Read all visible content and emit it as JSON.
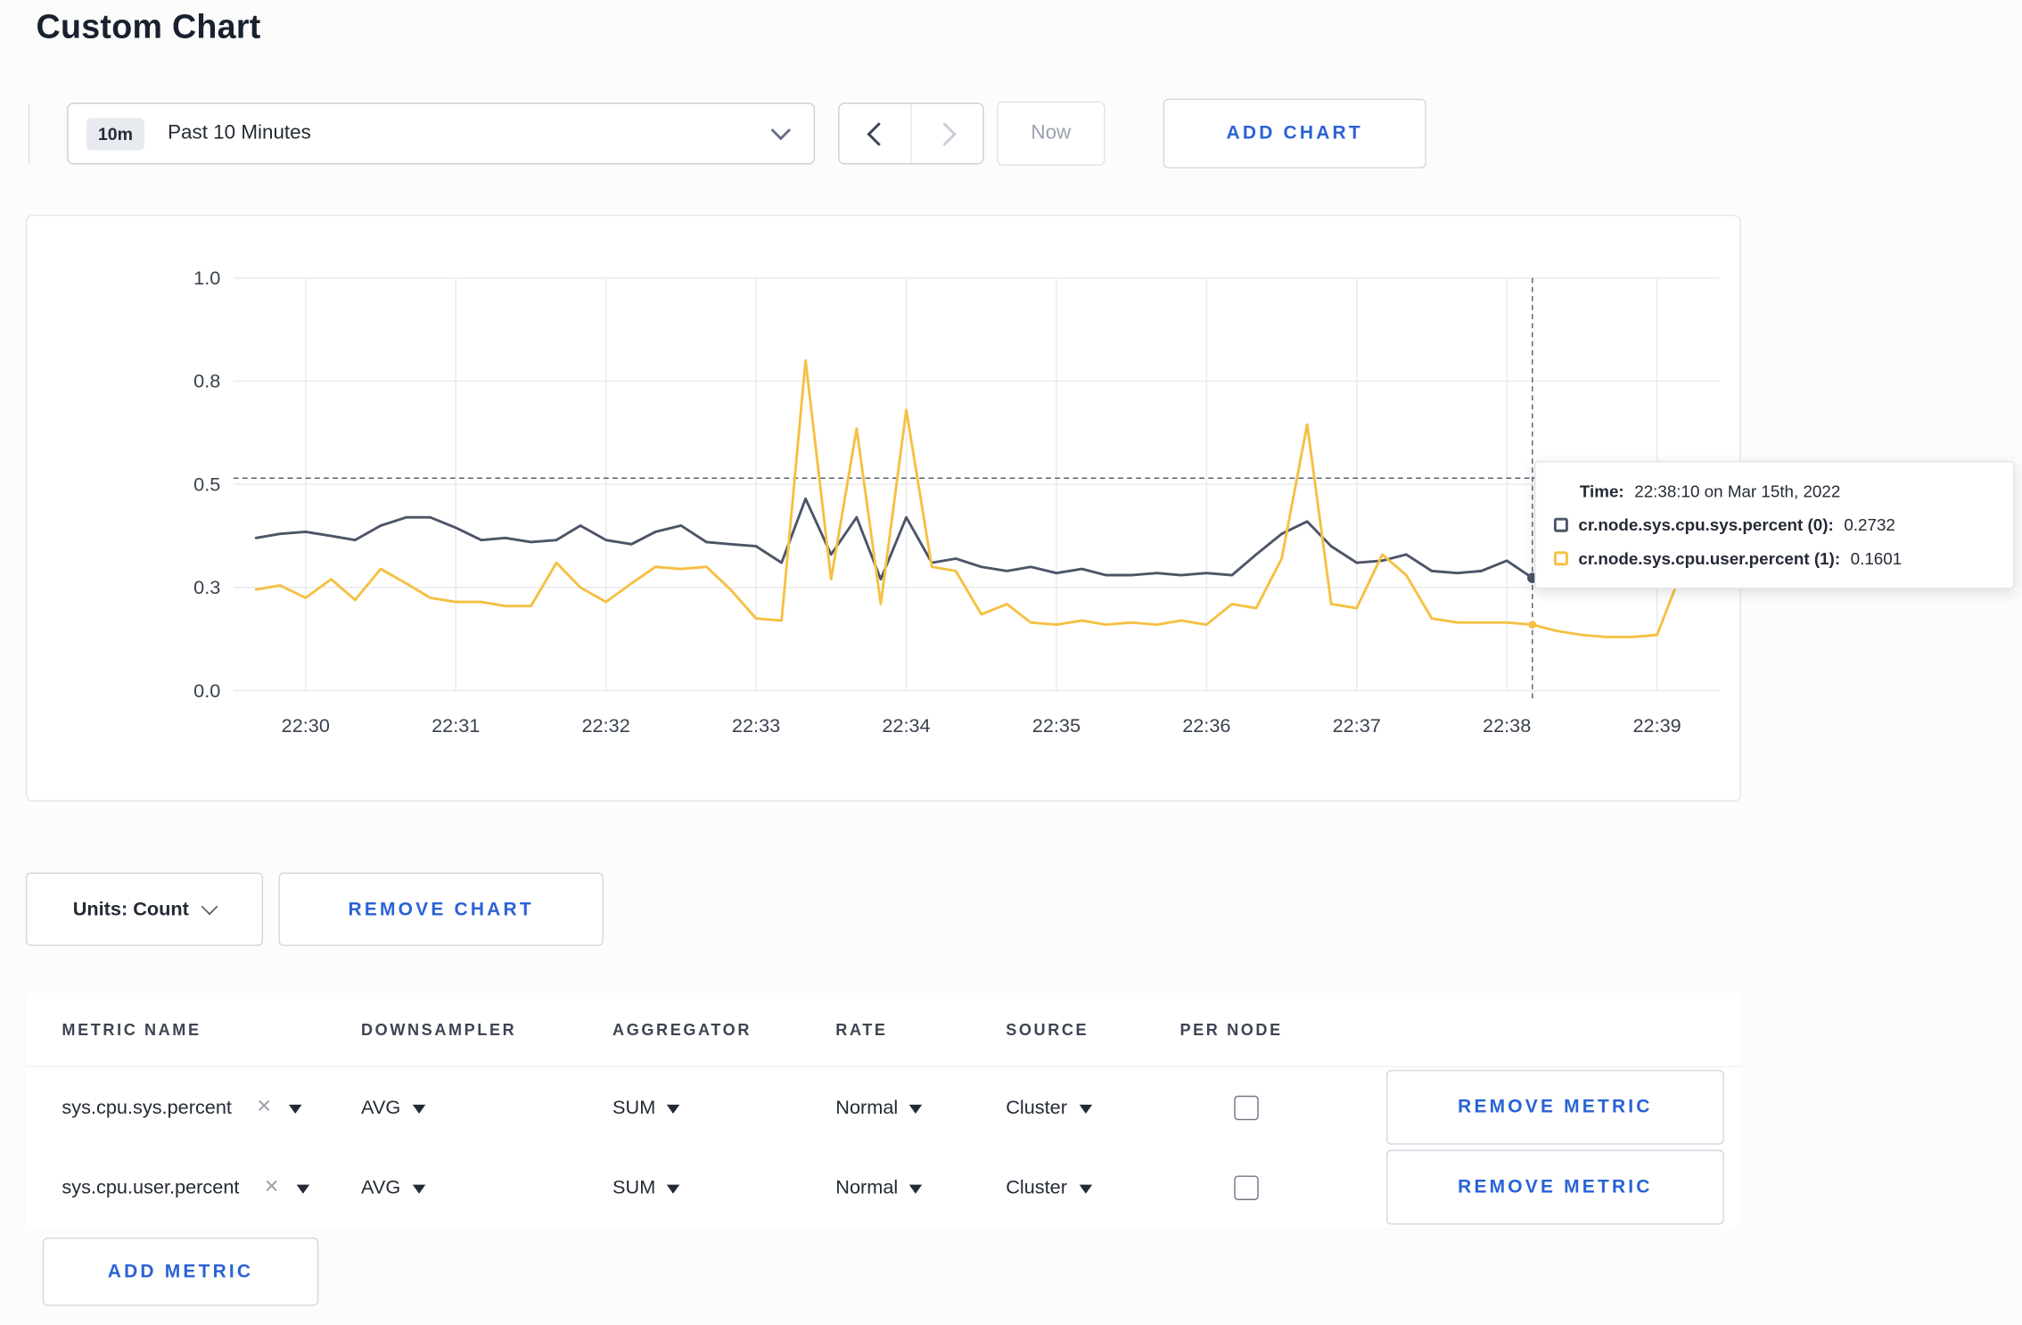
{
  "page": {
    "title": "Custom Chart",
    "accent_blue": "#2a62d6",
    "background": "#fcfcfd"
  },
  "toolbar": {
    "range_badge": "10m",
    "range_label": "Past 10 Minutes",
    "now_label": "Now",
    "add_chart_label": "ADD CHART"
  },
  "tooltip": {
    "time_label": "Time:",
    "time_value": "22:38:10 on Mar 15th, 2022",
    "rows": [
      {
        "label": "cr.node.sys.cpu.sys.percent (0):",
        "value": "0.2732",
        "color": "#4c5567"
      },
      {
        "label": "cr.node.sys.cpu.user.percent (1):",
        "value": "0.1601",
        "color": "#f5c043"
      }
    ]
  },
  "chart_footer": {
    "units_label": "Units: Count",
    "remove_chart_label": "REMOVE CHART"
  },
  "metrics_table": {
    "headers": [
      "METRIC NAME",
      "DOWNSAMPLER",
      "AGGREGATOR",
      "RATE",
      "SOURCE",
      "PER NODE"
    ],
    "rows": [
      {
        "metric": "sys.cpu.sys.percent",
        "downsampler": "AVG",
        "aggregator": "SUM",
        "rate": "Normal",
        "source": "Cluster",
        "per_node_checked": false,
        "remove_label": "REMOVE METRIC"
      },
      {
        "metric": "sys.cpu.user.percent",
        "downsampler": "AVG",
        "aggregator": "SUM",
        "rate": "Normal",
        "source": "Cluster",
        "per_node_checked": false,
        "remove_label": "REMOVE METRIC"
      }
    ],
    "add_metric_label": "ADD METRIC"
  },
  "chart_data": {
    "type": "line",
    "title": "",
    "grid": true,
    "y_domain": [
      0,
      1
    ],
    "y_ticks": [
      {
        "v": 0,
        "label": "0.0"
      },
      {
        "v": 0.25,
        "label": "0.3"
      },
      {
        "v": 0.5,
        "label": "0.5"
      },
      {
        "v": 0.75,
        "label": "0.8"
      },
      {
        "v": 1,
        "label": "1.0"
      }
    ],
    "x_ticks": [
      {
        "v": 30,
        "label": "22:30"
      },
      {
        "v": 31,
        "label": "22:31"
      },
      {
        "v": 32,
        "label": "22:32"
      },
      {
        "v": 33,
        "label": "22:33"
      },
      {
        "v": 34,
        "label": "22:34"
      },
      {
        "v": 35,
        "label": "22:35"
      },
      {
        "v": 36,
        "label": "22:36"
      },
      {
        "v": 37,
        "label": "22:37"
      },
      {
        "v": 38,
        "label": "22:38"
      },
      {
        "v": 39,
        "label": "22:39"
      }
    ],
    "crosshair": {
      "x": 38.17,
      "y": 0.515
    },
    "markers": [
      {
        "x": 38.17,
        "y": 0.2732,
        "color": "#4c5567",
        "r": 4
      },
      {
        "x": 38.17,
        "y": 0.1601,
        "color": "#f5c043",
        "r": 3
      }
    ],
    "series": [
      {
        "name": "cr.node.sys.cpu.sys.percent",
        "color": "#4c5567",
        "points": [
          [
            29.67,
            0.37
          ],
          [
            29.83,
            0.38
          ],
          [
            30,
            0.385
          ],
          [
            30.17,
            0.375
          ],
          [
            30.33,
            0.365
          ],
          [
            30.5,
            0.4
          ],
          [
            30.67,
            0.42
          ],
          [
            30.83,
            0.42
          ],
          [
            31,
            0.395
          ],
          [
            31.17,
            0.365
          ],
          [
            31.33,
            0.37
          ],
          [
            31.5,
            0.36
          ],
          [
            31.67,
            0.365
          ],
          [
            31.83,
            0.4
          ],
          [
            32,
            0.365
          ],
          [
            32.17,
            0.355
          ],
          [
            32.33,
            0.385
          ],
          [
            32.5,
            0.4
          ],
          [
            32.67,
            0.36
          ],
          [
            32.83,
            0.355
          ],
          [
            33,
            0.35
          ],
          [
            33.17,
            0.31
          ],
          [
            33.33,
            0.465
          ],
          [
            33.5,
            0.33
          ],
          [
            33.67,
            0.42
          ],
          [
            33.83,
            0.27
          ],
          [
            34,
            0.42
          ],
          [
            34.17,
            0.31
          ],
          [
            34.33,
            0.32
          ],
          [
            34.5,
            0.3
          ],
          [
            34.67,
            0.29
          ],
          [
            34.83,
            0.3
          ],
          [
            35,
            0.285
          ],
          [
            35.17,
            0.295
          ],
          [
            35.33,
            0.28
          ],
          [
            35.5,
            0.28
          ],
          [
            35.67,
            0.285
          ],
          [
            35.83,
            0.28
          ],
          [
            36,
            0.285
          ],
          [
            36.17,
            0.28
          ],
          [
            36.33,
            0.33
          ],
          [
            36.5,
            0.38
          ],
          [
            36.67,
            0.41
          ],
          [
            36.83,
            0.35
          ],
          [
            37,
            0.31
          ],
          [
            37.17,
            0.315
          ],
          [
            37.33,
            0.33
          ],
          [
            37.5,
            0.29
          ],
          [
            37.67,
            0.285
          ],
          [
            37.83,
            0.29
          ],
          [
            38,
            0.315
          ],
          [
            38.17,
            0.2732
          ]
        ]
      },
      {
        "name": "cr.node.sys.cpu.user.percent",
        "color": "#f5c043",
        "points": [
          [
            29.67,
            0.245
          ],
          [
            29.83,
            0.255
          ],
          [
            30,
            0.225
          ],
          [
            30.17,
            0.27
          ],
          [
            30.33,
            0.22
          ],
          [
            30.5,
            0.295
          ],
          [
            30.67,
            0.26
          ],
          [
            30.83,
            0.225
          ],
          [
            31,
            0.215
          ],
          [
            31.17,
            0.215
          ],
          [
            31.33,
            0.205
          ],
          [
            31.5,
            0.205
          ],
          [
            31.67,
            0.31
          ],
          [
            31.83,
            0.25
          ],
          [
            32,
            0.215
          ],
          [
            32.17,
            0.26
          ],
          [
            32.33,
            0.3
          ],
          [
            32.5,
            0.295
          ],
          [
            32.67,
            0.3
          ],
          [
            32.83,
            0.245
          ],
          [
            33,
            0.175
          ],
          [
            33.17,
            0.17
          ],
          [
            33.33,
            0.8
          ],
          [
            33.5,
            0.27
          ],
          [
            33.67,
            0.635
          ],
          [
            33.83,
            0.21
          ],
          [
            34,
            0.68
          ],
          [
            34.17,
            0.3
          ],
          [
            34.33,
            0.29
          ],
          [
            34.5,
            0.185
          ],
          [
            34.67,
            0.21
          ],
          [
            34.83,
            0.165
          ],
          [
            35,
            0.16
          ],
          [
            35.17,
            0.17
          ],
          [
            35.33,
            0.16
          ],
          [
            35.5,
            0.165
          ],
          [
            35.67,
            0.16
          ],
          [
            35.83,
            0.17
          ],
          [
            36,
            0.16
          ],
          [
            36.17,
            0.21
          ],
          [
            36.33,
            0.2
          ],
          [
            36.5,
            0.32
          ],
          [
            36.67,
            0.645
          ],
          [
            36.83,
            0.21
          ],
          [
            37,
            0.2
          ],
          [
            37.17,
            0.33
          ],
          [
            37.33,
            0.28
          ],
          [
            37.5,
            0.175
          ],
          [
            37.67,
            0.165
          ],
          [
            37.83,
            0.165
          ],
          [
            38,
            0.165
          ],
          [
            38.17,
            0.1601
          ],
          [
            38.33,
            0.145
          ],
          [
            38.5,
            0.135
          ],
          [
            38.67,
            0.13
          ],
          [
            38.83,
            0.13
          ],
          [
            39,
            0.135
          ],
          [
            39.17,
            0.295
          ],
          [
            39.33,
            0.26
          ]
        ]
      }
    ]
  }
}
